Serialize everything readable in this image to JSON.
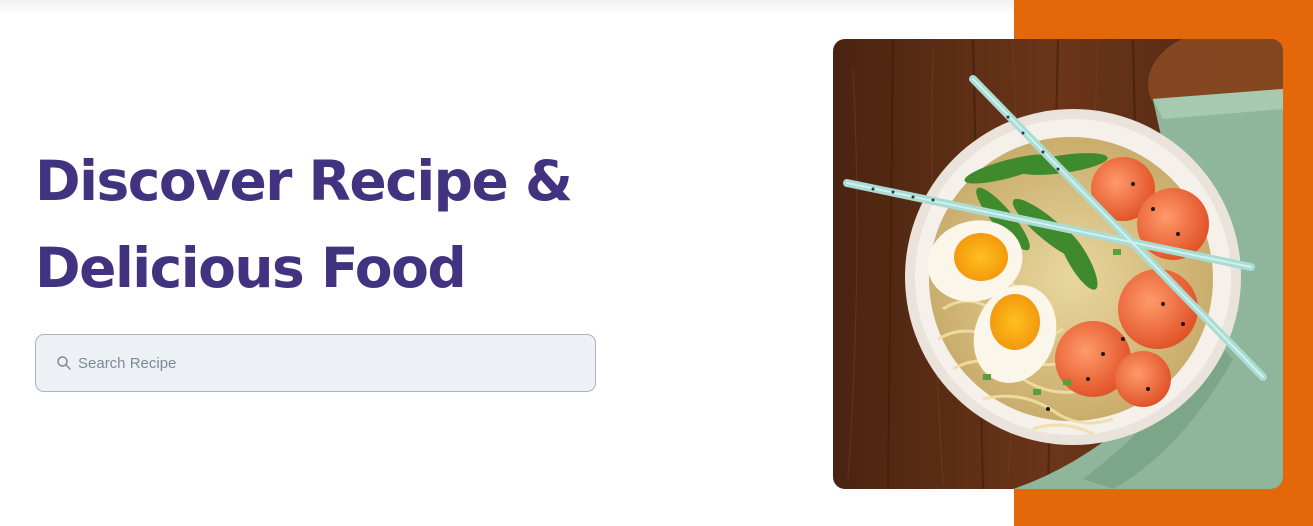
{
  "hero": {
    "title_line1": "Discover Recipe &",
    "title_line2": "Delicious Food"
  },
  "search": {
    "placeholder": "Search Recipe",
    "value": "",
    "icon": "search-icon"
  },
  "image": {
    "subject": "ramen-bowl-photo"
  },
  "colors": {
    "title": "#41337f",
    "accent_block": "#e4670a",
    "search_bg": "#edf1f6"
  }
}
